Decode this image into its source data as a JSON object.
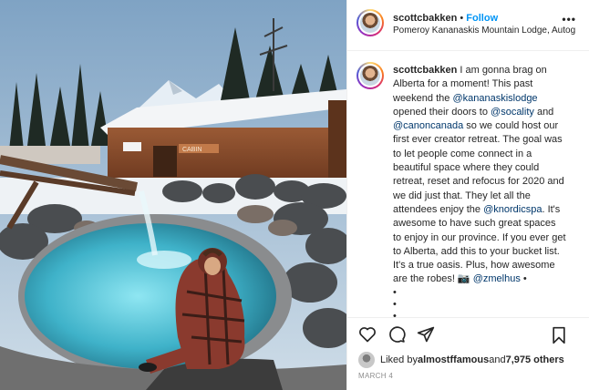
{
  "post": {
    "username": "scottcbakken",
    "separator": "•",
    "follow_label": "Follow",
    "location": "Pomeroy Kananaskis Mountain Lodge, Autogr...",
    "more_icon": "ellipsis-icon",
    "photo_sign_text": "CABIN"
  },
  "caption": {
    "username": "scottcbakken",
    "parts": [
      " I am gonna brag on Alberta for a moment! This past weekend the ",
      "@kananaskislodge",
      " opened their doors to ",
      "@socality",
      " and ",
      "@canoncanada",
      " so we could host our first ever creator retreat. The goal was to let people come connect in a beautiful space where they could retreat, reset and refocus for 2020 and we did just that. They let all the attendees enjoy the ",
      "@knordicspa",
      ". It's awesome to have such great spaces to enjoy in our province. If you ever get to Alberta, add this to your bucket list. It's a true oasis. Plus, how awesome are the robes! 📷 ",
      "@zmelhus",
      " •"
    ],
    "bullets": [
      "•",
      "•",
      "•"
    ]
  },
  "actions": {
    "like_icon": "heart-icon",
    "comment_icon": "comment-icon",
    "share_icon": "share-icon",
    "save_icon": "bookmark-icon"
  },
  "likes": {
    "prefix": "Liked by ",
    "user": "almostffamous",
    "middle": " and ",
    "others": "7,975 others"
  },
  "date": "MARCH 4",
  "colors": {
    "link": "#00376b",
    "follow": "#0095f6",
    "muted": "#8e8e8e",
    "text": "#262626"
  }
}
